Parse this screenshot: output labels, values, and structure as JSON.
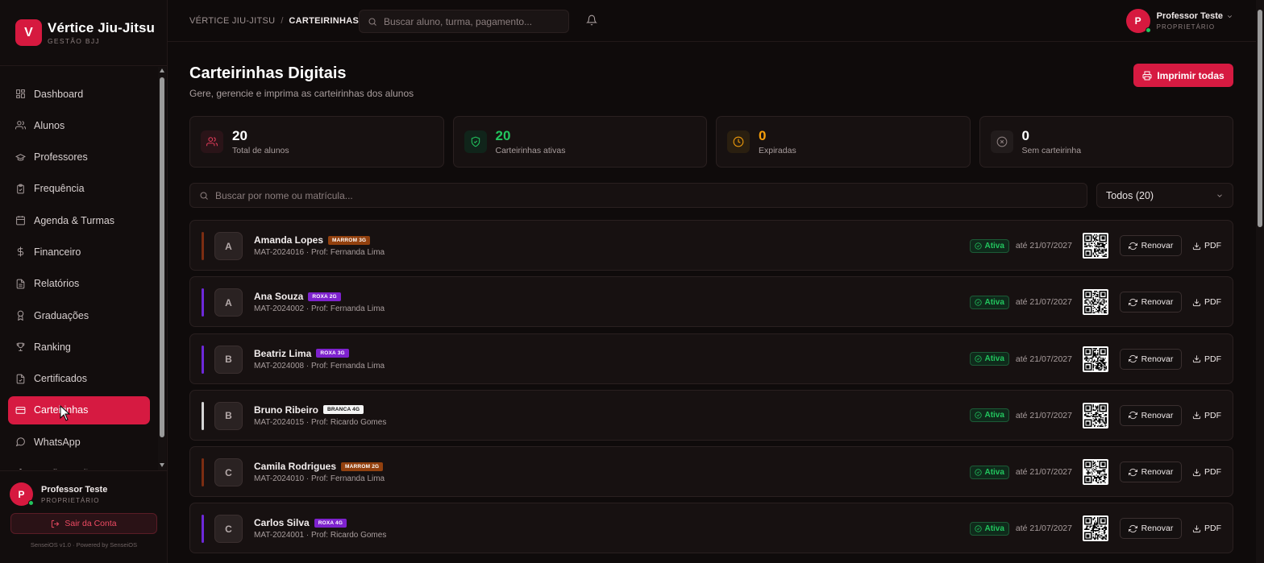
{
  "brand": {
    "logo_letter": "V",
    "name": "Vértice Jiu-Jitsu",
    "subtitle": "GESTÃO BJJ",
    "color": "#d6193f"
  },
  "sidebar": {
    "items": [
      {
        "label": "Dashboard",
        "icon": "dashboard-icon"
      },
      {
        "label": "Alunos",
        "icon": "users-icon"
      },
      {
        "label": "Professores",
        "icon": "graduation-cap-icon"
      },
      {
        "label": "Frequência",
        "icon": "clipboard-check-icon"
      },
      {
        "label": "Agenda & Turmas",
        "icon": "calendar-icon"
      },
      {
        "label": "Financeiro",
        "icon": "dollar-icon"
      },
      {
        "label": "Relatórios",
        "icon": "file-text-icon"
      },
      {
        "label": "Graduações",
        "icon": "award-icon"
      },
      {
        "label": "Ranking",
        "icon": "trophy-icon"
      },
      {
        "label": "Certificados",
        "icon": "certificate-icon"
      },
      {
        "label": "Carteirinhas",
        "icon": "id-card-icon",
        "active": true
      },
      {
        "label": "WhatsApp",
        "icon": "message-circle-icon"
      },
      {
        "label": "Configurações",
        "icon": "settings-icon"
      }
    ],
    "user": {
      "initial": "P",
      "name": "Professor Teste",
      "role": "PROPRIETÁRIO"
    },
    "logout_label": "Sair da Conta",
    "version": "SenseiOS v1.0 · Powered by SenseiOS"
  },
  "header": {
    "breadcrumb": [
      "VÉRTICE JIU-JITSU",
      "CARTEIRINHAS"
    ],
    "search_placeholder": "Buscar aluno, turma, pagamento...",
    "user": {
      "initial": "P",
      "name": "Professor Teste",
      "role": "PROPRIETÁRIO"
    }
  },
  "page": {
    "title": "Carteirinhas Digitais",
    "subtitle": "Gere, gerencie e imprima as carteirinhas dos alunos",
    "print_all_label": "Imprimir todas"
  },
  "stats": [
    {
      "value": "20",
      "label": "Total de alunos",
      "icon": "users-icon",
      "color": "#ffffff",
      "icon_color": "#e23b5a",
      "icon_bg": "#2a1418"
    },
    {
      "value": "20",
      "label": "Carteirinhas ativas",
      "icon": "shield-check-icon",
      "color": "#22c55e",
      "icon_color": "#22c55e",
      "icon_bg": "#10241a"
    },
    {
      "value": "0",
      "label": "Expiradas",
      "icon": "clock-icon",
      "color": "#f59e0b",
      "icon_color": "#f59e0b",
      "icon_bg": "#2a1f10"
    },
    {
      "value": "0",
      "label": "Sem carteirinha",
      "icon": "x-circle-icon",
      "color": "#ffffff",
      "icon_color": "#8b7e7e",
      "icon_bg": "#221c1c"
    }
  ],
  "filters": {
    "search_placeholder": "Buscar por nome ou matrícula...",
    "select_value": "Todos (20)"
  },
  "students": [
    {
      "initial": "A",
      "name": "Amanda Lopes",
      "belt": "MARROM 3G",
      "belt_color": "#92400e",
      "belt_text": "#ffffff",
      "bar_color": "#7c2d12",
      "meta": "MAT-2024016 · Prof: Fernanda Lima",
      "status": "Ativa",
      "until": "até 21/07/2027"
    },
    {
      "initial": "A",
      "name": "Ana Souza",
      "belt": "ROXA 2G",
      "belt_color": "#7e22ce",
      "belt_text": "#ffffff",
      "bar_color": "#6d28d9",
      "meta": "MAT-2024002 · Prof: Fernanda Lima",
      "status": "Ativa",
      "until": "até 21/07/2027"
    },
    {
      "initial": "B",
      "name": "Beatriz Lima",
      "belt": "ROXA 3G",
      "belt_color": "#7e22ce",
      "belt_text": "#ffffff",
      "bar_color": "#6d28d9",
      "meta": "MAT-2024008 · Prof: Fernanda Lima",
      "status": "Ativa",
      "until": "até 21/07/2027"
    },
    {
      "initial": "B",
      "name": "Bruno Ribeiro",
      "belt": "BRANCA 4G",
      "belt_color": "#f5f5f5",
      "belt_text": "#111111",
      "bar_color": "#d4d4d4",
      "meta": "MAT-2024015 · Prof: Ricardo Gomes",
      "status": "Ativa",
      "until": "até 21/07/2027"
    },
    {
      "initial": "C",
      "name": "Camila Rodrigues",
      "belt": "MARROM 2G",
      "belt_color": "#92400e",
      "belt_text": "#ffffff",
      "bar_color": "#7c2d12",
      "meta": "MAT-2024010 · Prof: Fernanda Lima",
      "status": "Ativa",
      "until": "até 21/07/2027"
    },
    {
      "initial": "C",
      "name": "Carlos Silva",
      "belt": "ROXA 4G",
      "belt_color": "#7e22ce",
      "belt_text": "#ffffff",
      "bar_color": "#6d28d9",
      "meta": "MAT-2024001 · Prof: Ricardo Gomes",
      "status": "Ativa",
      "until": "até 21/07/2027"
    }
  ],
  "row_actions": {
    "renew_label": "Renovar",
    "pdf_label": "PDF"
  }
}
